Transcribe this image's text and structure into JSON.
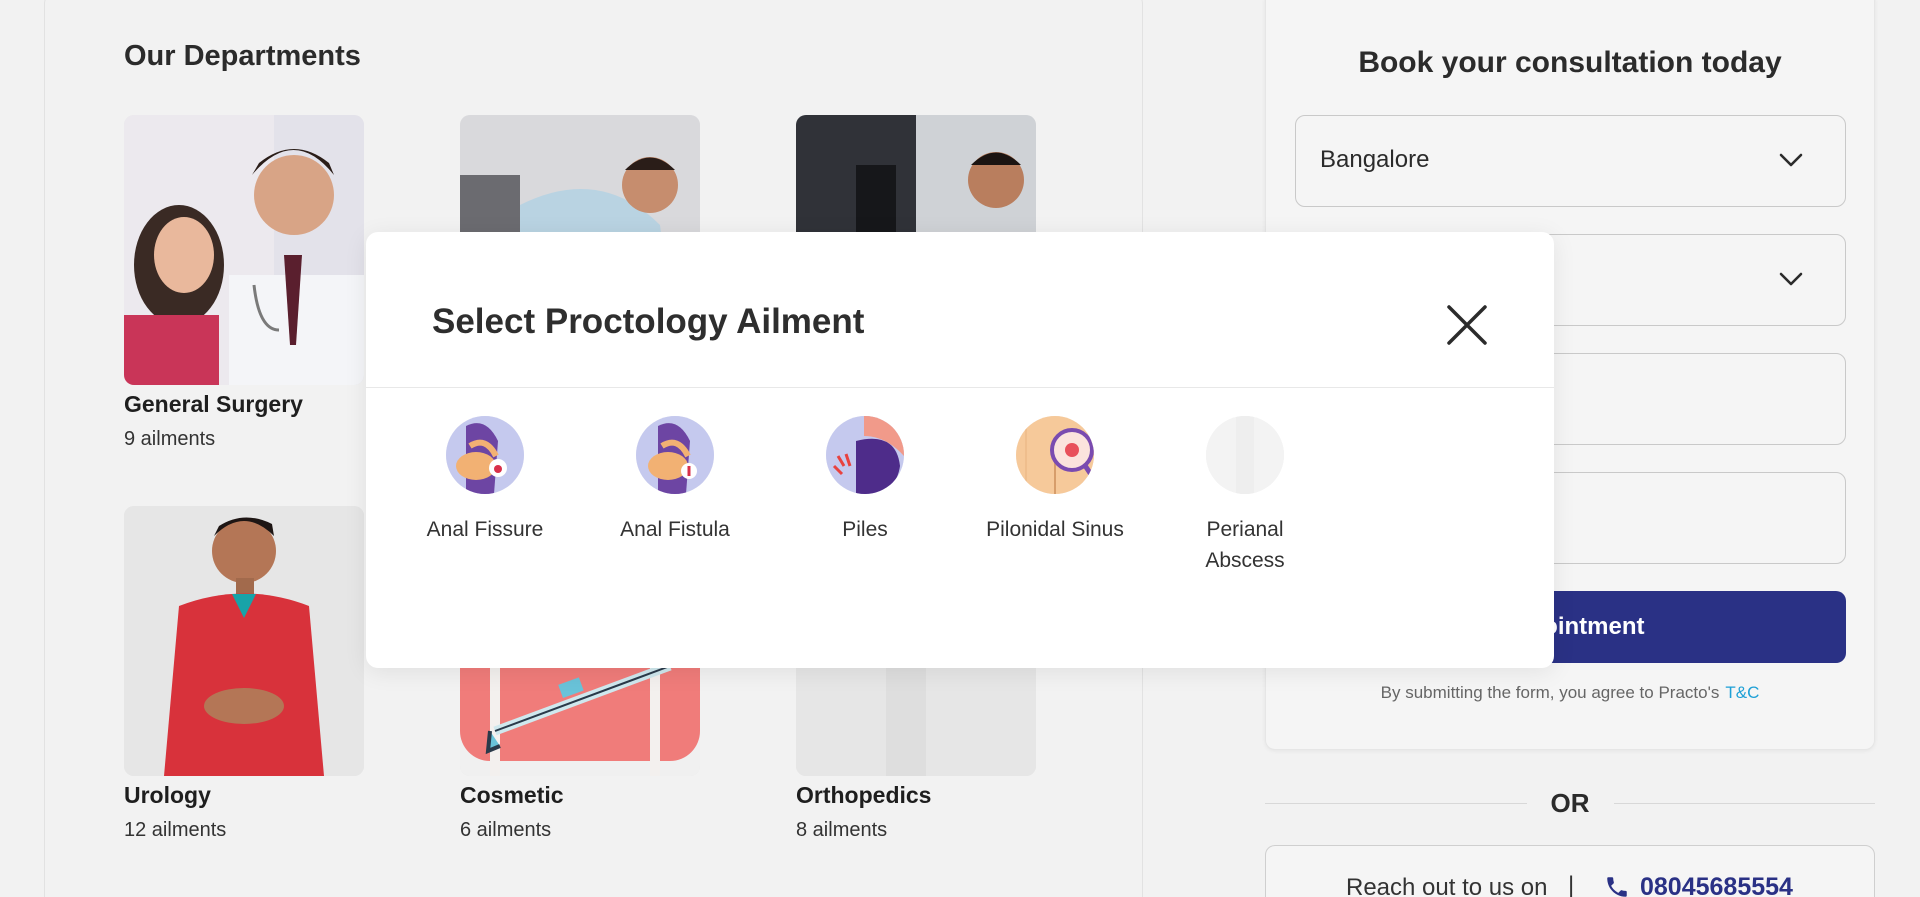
{
  "departments": {
    "title": "Our Departments",
    "items": [
      {
        "name": "General Surgery",
        "count": "9 ailments"
      },
      {
        "name": "Urology",
        "count": "12 ailments"
      },
      {
        "name": "Cosmetic",
        "count": "6 ailments"
      },
      {
        "name": "Orthopedics",
        "count": "8 ailments"
      }
    ]
  },
  "booking": {
    "title": "Book your consultation today",
    "city_value": "Bangalore",
    "button_label": "Appointment",
    "terms_text": "By submitting the form, you agree to Practo's",
    "terms_link": "T&C"
  },
  "contact": {
    "or_label": "OR",
    "reach_text": "Reach out to us on",
    "separator": "|",
    "phone": "08045685554"
  },
  "modal": {
    "title": "Select Proctology Ailment",
    "ailments": [
      {
        "label": "Anal Fissure"
      },
      {
        "label": "Anal Fistula"
      },
      {
        "label": "Piles"
      },
      {
        "label": "Pilonidal Sinus"
      },
      {
        "label": "Perianal Abscess"
      }
    ]
  },
  "colors": {
    "primary": "#2a3185",
    "link": "#1ea0d6",
    "background": "#f2f2f2"
  }
}
